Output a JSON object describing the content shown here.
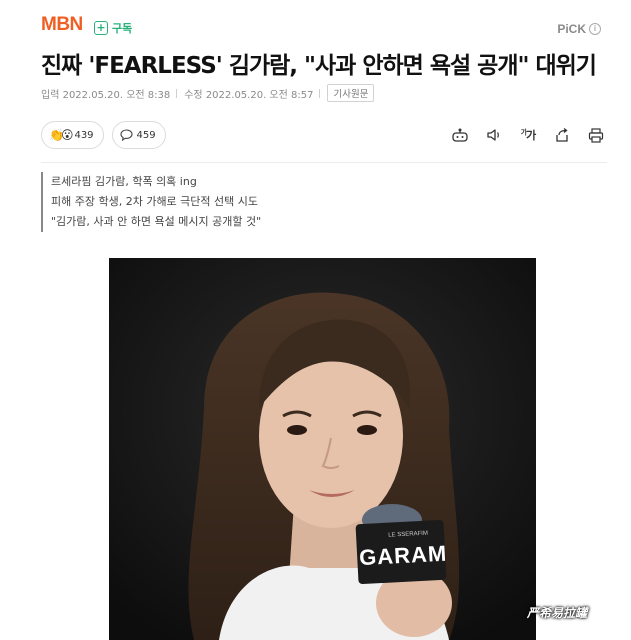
{
  "header": {
    "logo": "MBN",
    "subscribe_label": "구독",
    "pick_label": "PiCK",
    "pick_info": "i"
  },
  "article": {
    "title": "진짜 'FEARLESS' 김가람, \"사과 안하면 욕설 공개\" 대위기",
    "published": "입력 2022.05.20. 오전 8:38",
    "modified": "수정 2022.05.20. 오전 8:57",
    "original_link": "기사원문",
    "summary": [
      "르세라핌 김가람, 학폭 의혹 ing",
      "피해 주장 학생, 2차 가해로 극단적 선택 시도",
      "\"김가람, 사과 안 하면 욕설 메시지 공개할 것\""
    ],
    "photo": {
      "mic_text": "GARAM",
      "mic_small_text": "LE SSERAFIM"
    }
  },
  "reactions": {
    "like_count": "439",
    "comment_count": "459"
  },
  "toolbar": {
    "font_size_label": "가"
  },
  "watermark": "严希易拉罐",
  "colors": {
    "brand": "#ef5f24",
    "subscribe": "#27b27b"
  }
}
